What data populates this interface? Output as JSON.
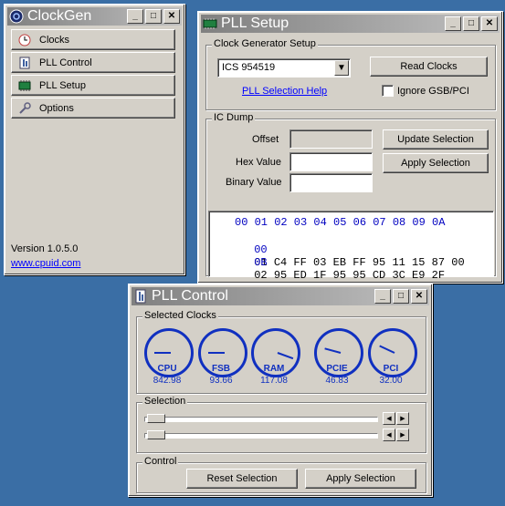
{
  "clockgen": {
    "title": "ClockGen",
    "nav": [
      {
        "label": "Clocks",
        "icon": "clock-icon"
      },
      {
        "label": "PLL Control",
        "icon": "pll-control-icon"
      },
      {
        "label": "PLL Setup",
        "icon": "chip-icon"
      },
      {
        "label": "Options",
        "icon": "wrench-icon"
      }
    ],
    "version": "Version 1.0.5.0",
    "website": "www.cpuid.com"
  },
  "pll_setup": {
    "title": "PLL Setup",
    "group_clock": "Clock Generator Setup",
    "selected_chip": "ICS 954519",
    "read_clocks": "Read Clocks",
    "help_link": "PLL Selection Help",
    "ignore_label": "Ignore GSB/PCI",
    "group_dump": "IC Dump",
    "offset_label": "Offset",
    "hex_label": "Hex Value",
    "binary_label": "Binary Value",
    "update_selection": "Update Selection",
    "apply_selection": "Apply Selection",
    "dump_header": "00 01 02 03 04 05 06 07 08 09 0A",
    "dump_rows": [
      {
        "addr": "00",
        "bytes": "01 C4 FF 03 EB FF 95 11 15 87 00"
      },
      {
        "addr": "0B",
        "bytes": "02 95 ED 1F 95 95 CD 3C E9 2F"
      }
    ]
  },
  "pll_control": {
    "title": "PLL Control",
    "group_clocks": "Selected Clocks",
    "gauges": [
      {
        "name": "CPU",
        "value": "842.98"
      },
      {
        "name": "FSB",
        "value": "93.66"
      },
      {
        "name": "RAM",
        "value": "117.08"
      },
      {
        "name": "PCIE",
        "value": "46.83"
      },
      {
        "name": "PCI",
        "value": "32.00"
      }
    ],
    "group_selection": "Selection",
    "group_control": "Control",
    "reset_selection": "Reset Selection",
    "apply_selection": "Apply Selection"
  },
  "colors": {
    "active_title": "#0a246a",
    "inactive_title": "#808080",
    "gauge_blue": "#1030c0",
    "desktop": "#3a6ea5"
  }
}
